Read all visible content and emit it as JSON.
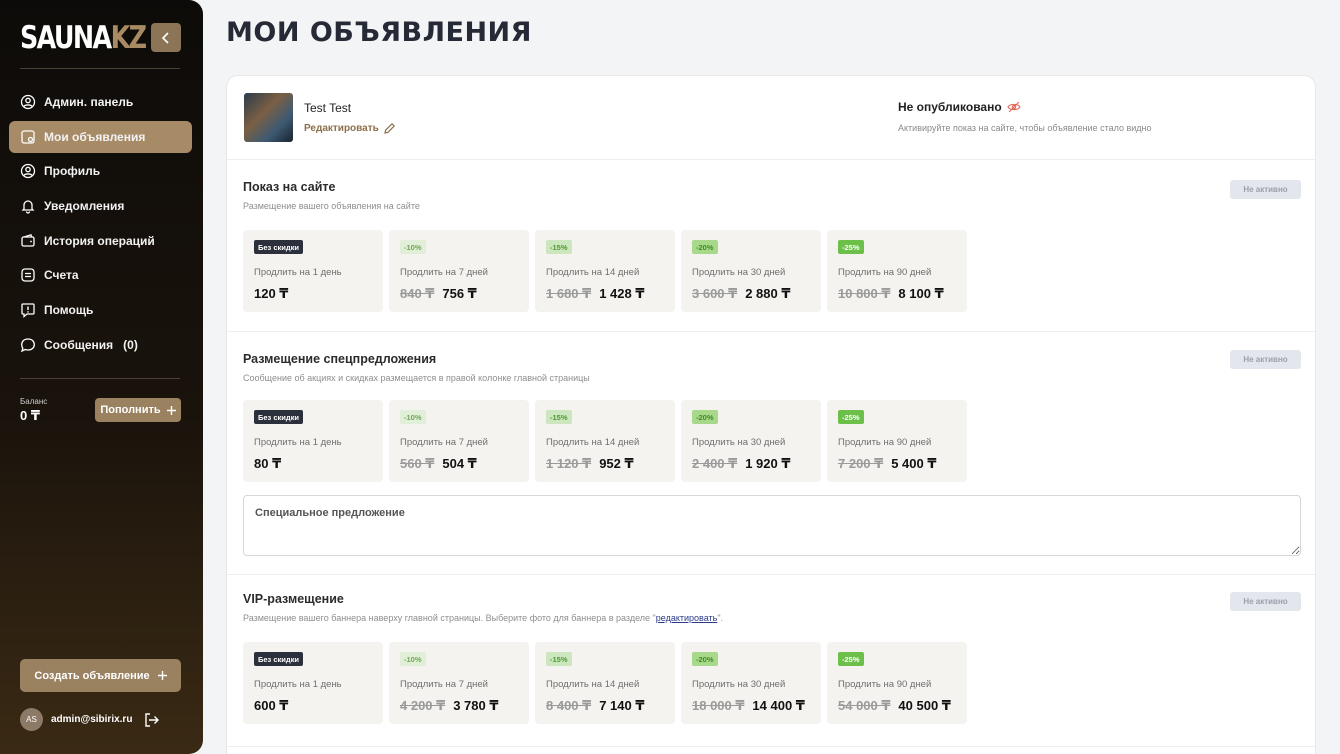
{
  "sidebar": {
    "logo_main": "SAUNA",
    "logo_accent": "KZ",
    "nav": [
      {
        "label": "Админ. панель",
        "icon": "user-circle-icon"
      },
      {
        "label": "Мои объявления",
        "icon": "listing-icon",
        "active": true
      },
      {
        "label": "Профиль",
        "icon": "profile-icon"
      },
      {
        "label": "Уведомления",
        "icon": "bell-icon"
      },
      {
        "label": "История операций",
        "icon": "wallet-icon"
      },
      {
        "label": "Счета",
        "icon": "invoice-icon"
      },
      {
        "label": "Помощь",
        "icon": "help-icon"
      },
      {
        "label": "Сообщения   (0)",
        "icon": "chat-icon"
      }
    ],
    "balance_label": "Баланс",
    "balance_value": "0 ₸",
    "topup_label": "Пополнить",
    "create_label": "Создать объявление",
    "user_initials": "AS",
    "user_email": "admin@sibirix.ru"
  },
  "page_title": "МОИ ОБЪЯВЛЕНИЯ",
  "listing": {
    "title": "Test Test",
    "edit_label": "Редактировать",
    "status": "Не опубликовано",
    "status_hint": "Активируйте показ на сайте, чтобы объявление стало видно"
  },
  "inactive_label": "Не активно",
  "sections": [
    {
      "title": "Показ на сайте",
      "desc": "Размещение вашего объявления на сайте",
      "options": [
        {
          "tag": "Без скидки",
          "dur": "Продлить на 1 день",
          "old": "",
          "new": "120 ₸"
        },
        {
          "tag": "-10%",
          "dur": "Продлить на 7 дней",
          "old": "840 ₸",
          "new": "756 ₸"
        },
        {
          "tag": "-15%",
          "dur": "Продлить на 14 дней",
          "old": "1 680 ₸",
          "new": "1 428 ₸"
        },
        {
          "tag": "-20%",
          "dur": "Продлить на 30 дней",
          "old": "3 600 ₸",
          "new": "2 880 ₸"
        },
        {
          "tag": "-25%",
          "dur": "Продлить на 90 дней",
          "old": "10 800 ₸",
          "new": "8 100 ₸"
        }
      ]
    },
    {
      "title": "Размещение спецпредложения",
      "desc": "Сообщение об акциях и скидках размещается в правой колонке главной страницы",
      "options": [
        {
          "tag": "Без скидки",
          "dur": "Продлить на 1 день",
          "old": "",
          "new": "80 ₸"
        },
        {
          "tag": "-10%",
          "dur": "Продлить на 7 дней",
          "old": "560 ₸",
          "new": "504 ₸"
        },
        {
          "tag": "-15%",
          "dur": "Продлить на 14 дней",
          "old": "1 120 ₸",
          "new": "952 ₸"
        },
        {
          "tag": "-20%",
          "dur": "Продлить на 30 дней",
          "old": "2 400 ₸",
          "new": "1 920 ₸"
        },
        {
          "tag": "-25%",
          "dur": "Продлить на 90 дней",
          "old": "7 200 ₸",
          "new": "5 400 ₸"
        }
      ],
      "input_placeholder": "Специальное предложение"
    },
    {
      "title": "VIP-размещение",
      "desc_before": "Размещение вашего баннера наверху главной страницы. Выберите фото для баннера в разделе \"",
      "desc_link": "редактировать",
      "desc_after": "\".",
      "options": [
        {
          "tag": "Без скидки",
          "dur": "Продлить на 1 день",
          "old": "",
          "new": "600 ₸"
        },
        {
          "tag": "-10%",
          "dur": "Продлить на 7 дней",
          "old": "4 200 ₸",
          "new": "3 780 ₸"
        },
        {
          "tag": "-15%",
          "dur": "Продлить на 14 дней",
          "old": "8 400 ₸",
          "new": "7 140 ₸"
        },
        {
          "tag": "-20%",
          "dur": "Продлить на 30 дней",
          "old": "18 000 ₸",
          "new": "14 400 ₸"
        },
        {
          "tag": "-25%",
          "dur": "Продлить на 90 дней",
          "old": "54 000 ₸",
          "new": "40 500 ₸"
        }
      ]
    }
  ]
}
